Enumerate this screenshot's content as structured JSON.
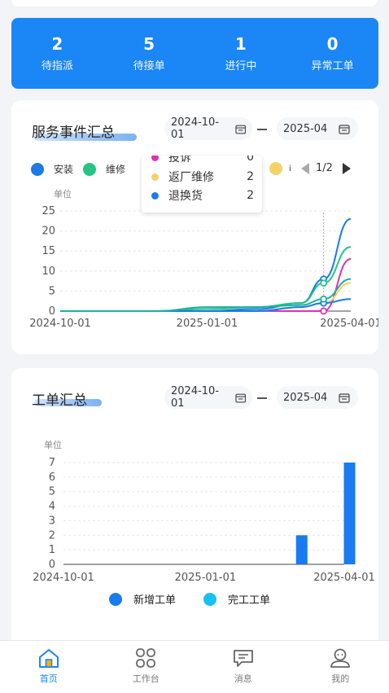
{
  "stats": [
    {
      "value": "2",
      "label": "待指派"
    },
    {
      "value": "5",
      "label": "待接单"
    },
    {
      "value": "1",
      "label": "进行中"
    },
    {
      "value": "0",
      "label": "异常工单"
    }
  ],
  "service_summary": {
    "title": "服务事件汇总",
    "start_date": "2024-10-01",
    "end_date": "2025-04",
    "legend": [
      {
        "name": "安装",
        "color": "#1b7ae6"
      },
      {
        "name": "维修",
        "color": "#24c583"
      },
      {
        "name": "i",
        "color": "#f2d36b"
      }
    ],
    "pager": "1/2",
    "tooltip": [
      {
        "name": "投诉",
        "value": "0",
        "color": "#e02fb5"
      },
      {
        "name": "返厂维修",
        "value": "2",
        "color": "#f2d36b"
      },
      {
        "name": "退换货",
        "value": "2",
        "color": "#1b7ae6"
      }
    ]
  },
  "work_order_summary": {
    "title": "工单汇总",
    "start_date": "2024-10-01",
    "end_date": "2025-04",
    "legend": [
      {
        "name": "新增工单",
        "color": "#1a7bf0"
      },
      {
        "name": "完工工单",
        "color": "#16c0f5"
      }
    ]
  },
  "chart_data": [
    {
      "type": "line",
      "ylabel": "单位",
      "ylim": [
        0,
        25
      ],
      "yticks": [
        "0",
        "5",
        "10",
        "15",
        "20",
        "25"
      ],
      "xticks": [
        "2024-10-01",
        "2025-01-01",
        "2025-04-01"
      ],
      "x": [
        "2024-10-01",
        "2024-11-01",
        "2024-12-01",
        "2025-01-01",
        "2025-02-01",
        "2025-03-01",
        "2025-03-15",
        "2025-04-01"
      ],
      "series": [
        {
          "name": "安装",
          "color": "#1b7ae6",
          "values": [
            0,
            0,
            0,
            0,
            0.5,
            2,
            8,
            23
          ]
        },
        {
          "name": "维修",
          "color": "#24c583",
          "values": [
            0,
            0,
            0,
            0.5,
            1,
            2,
            7,
            16
          ]
        },
        {
          "name": "投诉",
          "color": "#e02fb5",
          "values": [
            0,
            0,
            0,
            0,
            0,
            0,
            0,
            13
          ]
        },
        {
          "name": "返厂维修",
          "color": "#f2d36b",
          "values": [
            0,
            0,
            0,
            0,
            0,
            1,
            2,
            7
          ]
        },
        {
          "name": "退换货",
          "color": "#1b7ae6",
          "values": [
            0,
            0,
            0,
            0,
            0,
            1,
            2,
            3
          ]
        },
        {
          "color": "#1fb09a",
          "values": [
            0,
            0,
            0,
            1,
            1,
            1.5,
            3,
            8
          ]
        }
      ]
    },
    {
      "type": "bar",
      "ylabel": "单位",
      "ylim": [
        0,
        7
      ],
      "yticks": [
        "0",
        "1",
        "2",
        "3",
        "4",
        "5",
        "6",
        "7"
      ],
      "xticks": [
        "2024-10-01",
        "2025-01-01",
        "2025-04-01"
      ],
      "categories": [
        "2025-03",
        "2025-04"
      ],
      "series": [
        {
          "name": "新增工单",
          "color": "#1a7bf0",
          "values": [
            2,
            7
          ]
        },
        {
          "name": "完工工单",
          "color": "#16c0f5",
          "values": [
            0,
            0
          ]
        }
      ]
    }
  ],
  "tabbar": [
    {
      "label": "首页",
      "icon": "home-icon",
      "active": true
    },
    {
      "label": "工作台",
      "icon": "grid-icon",
      "active": false
    },
    {
      "label": "消息",
      "icon": "message-icon",
      "active": false
    },
    {
      "label": "我的",
      "icon": "user-icon",
      "active": false
    }
  ]
}
